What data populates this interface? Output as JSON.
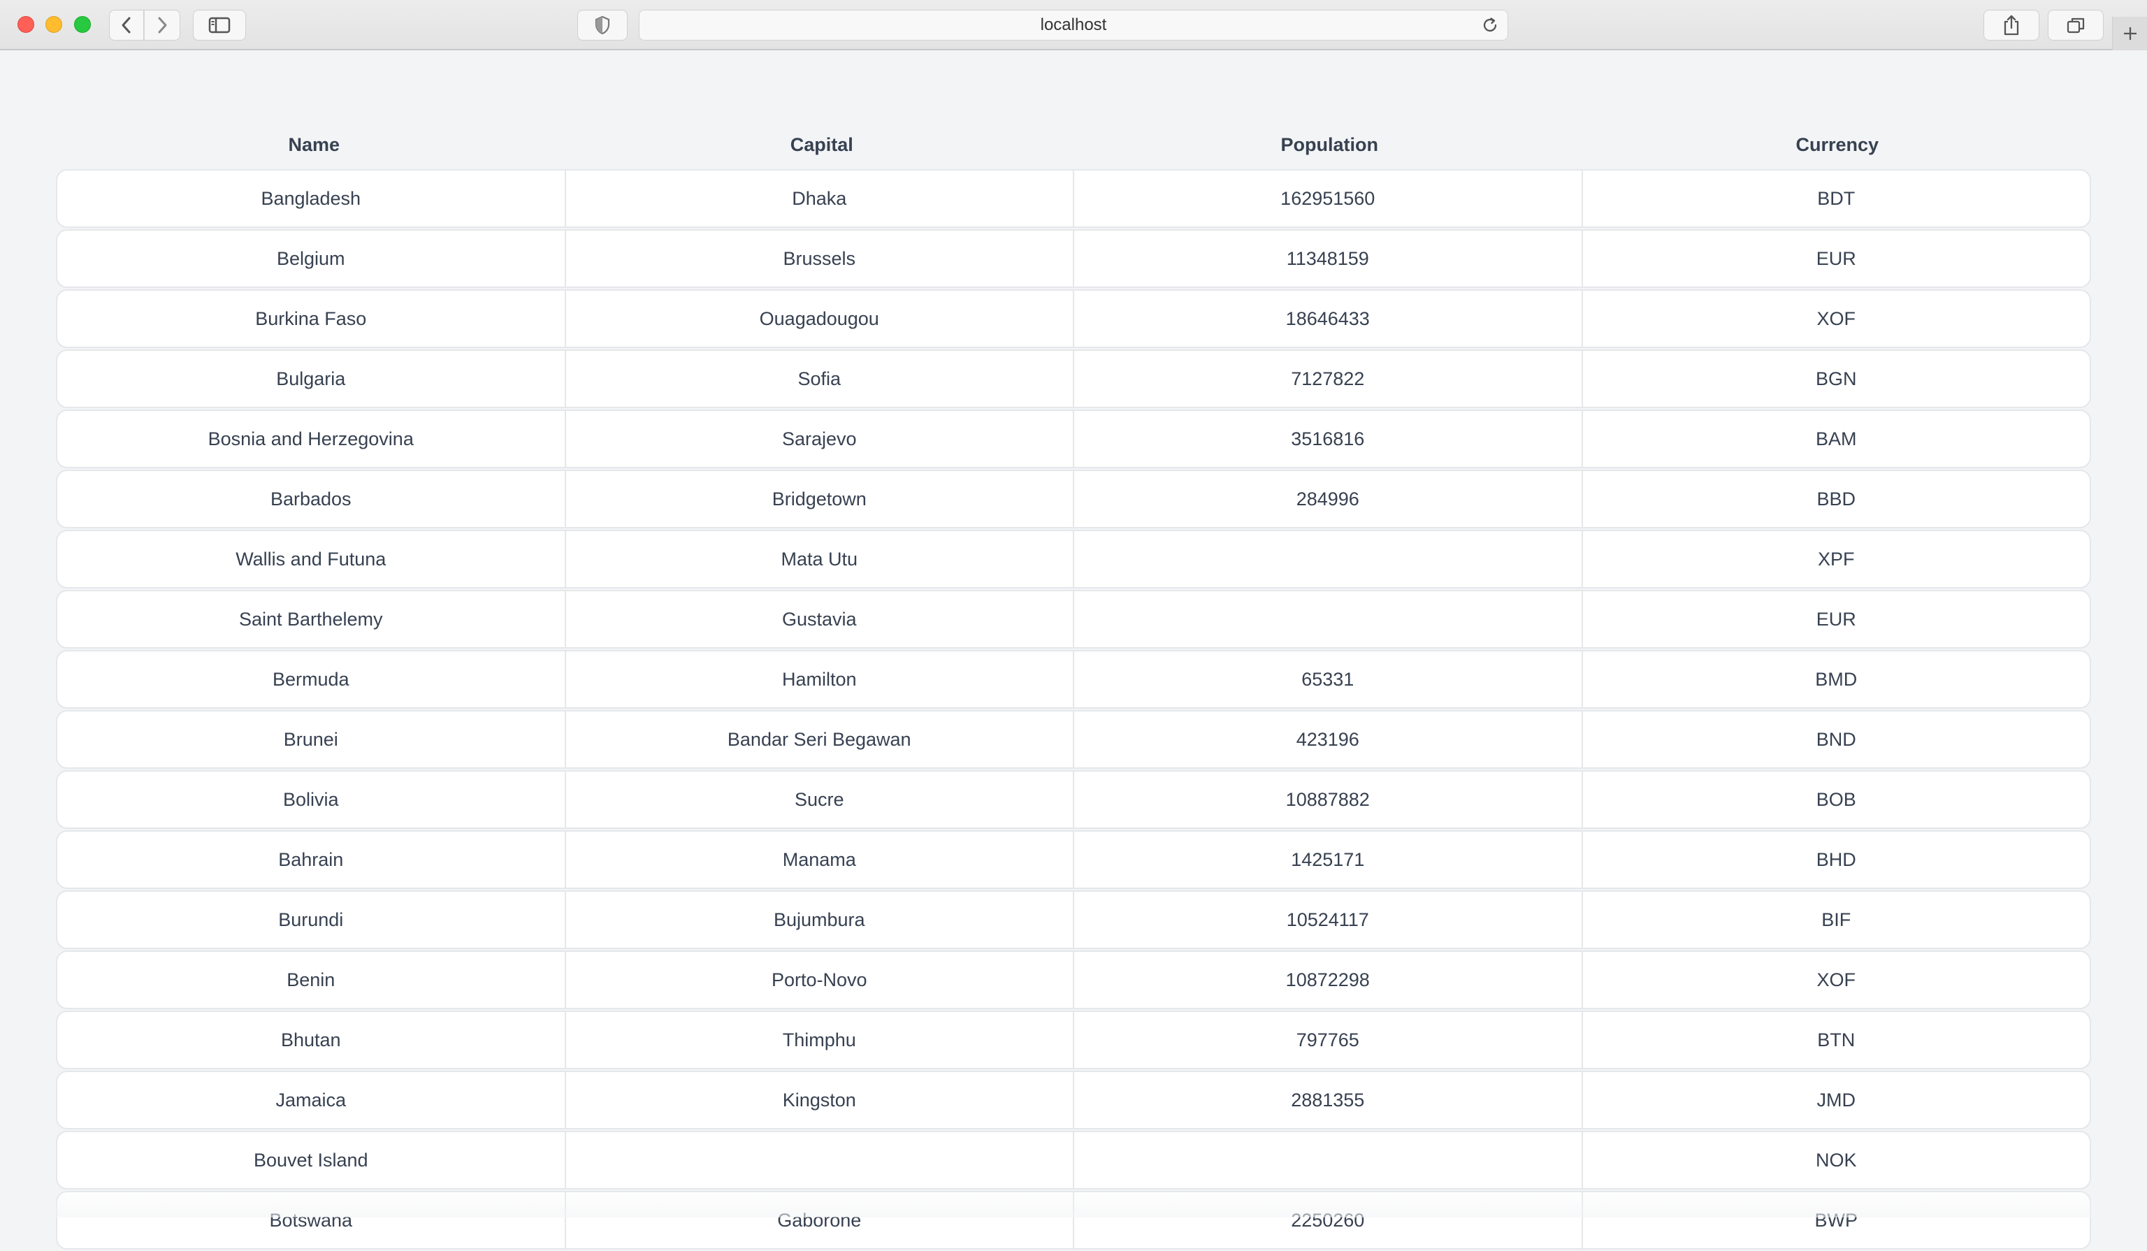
{
  "browser": {
    "url": "localhost",
    "icons": {
      "back": "chevron-left-icon",
      "forward": "chevron-right-icon",
      "sidebar": "sidebar-icon",
      "privacy": "shield-icon",
      "reload": "reload-icon",
      "share": "share-icon",
      "tabs": "tabs-overview-icon",
      "new_tab": "plus-icon"
    }
  },
  "table": {
    "headers": [
      "Name",
      "Capital",
      "Population",
      "Currency"
    ],
    "rows": [
      [
        "Bangladesh",
        "Dhaka",
        "162951560",
        "BDT"
      ],
      [
        "Belgium",
        "Brussels",
        "11348159",
        "EUR"
      ],
      [
        "Burkina Faso",
        "Ouagadougou",
        "18646433",
        "XOF"
      ],
      [
        "Bulgaria",
        "Sofia",
        "7127822",
        "BGN"
      ],
      [
        "Bosnia and Herzegovina",
        "Sarajevo",
        "3516816",
        "BAM"
      ],
      [
        "Barbados",
        "Bridgetown",
        "284996",
        "BBD"
      ],
      [
        "Wallis and Futuna",
        "Mata Utu",
        "",
        "XPF"
      ],
      [
        "Saint Barthelemy",
        "Gustavia",
        "",
        "EUR"
      ],
      [
        "Bermuda",
        "Hamilton",
        "65331",
        "BMD"
      ],
      [
        "Brunei",
        "Bandar Seri Begawan",
        "423196",
        "BND"
      ],
      [
        "Bolivia",
        "Sucre",
        "10887882",
        "BOB"
      ],
      [
        "Bahrain",
        "Manama",
        "1425171",
        "BHD"
      ],
      [
        "Burundi",
        "Bujumbura",
        "10524117",
        "BIF"
      ],
      [
        "Benin",
        "Porto-Novo",
        "10872298",
        "XOF"
      ],
      [
        "Bhutan",
        "Thimphu",
        "797765",
        "BTN"
      ],
      [
        "Jamaica",
        "Kingston",
        "2881355",
        "JMD"
      ],
      [
        "Bouvet Island",
        "",
        "",
        "NOK"
      ],
      [
        "Botswana",
        "Gaborone",
        "2250260",
        "BWP"
      ]
    ]
  },
  "colors": {
    "page_bg": "#f3f4f6",
    "border": "#e5e7eb",
    "text": "#374151"
  }
}
